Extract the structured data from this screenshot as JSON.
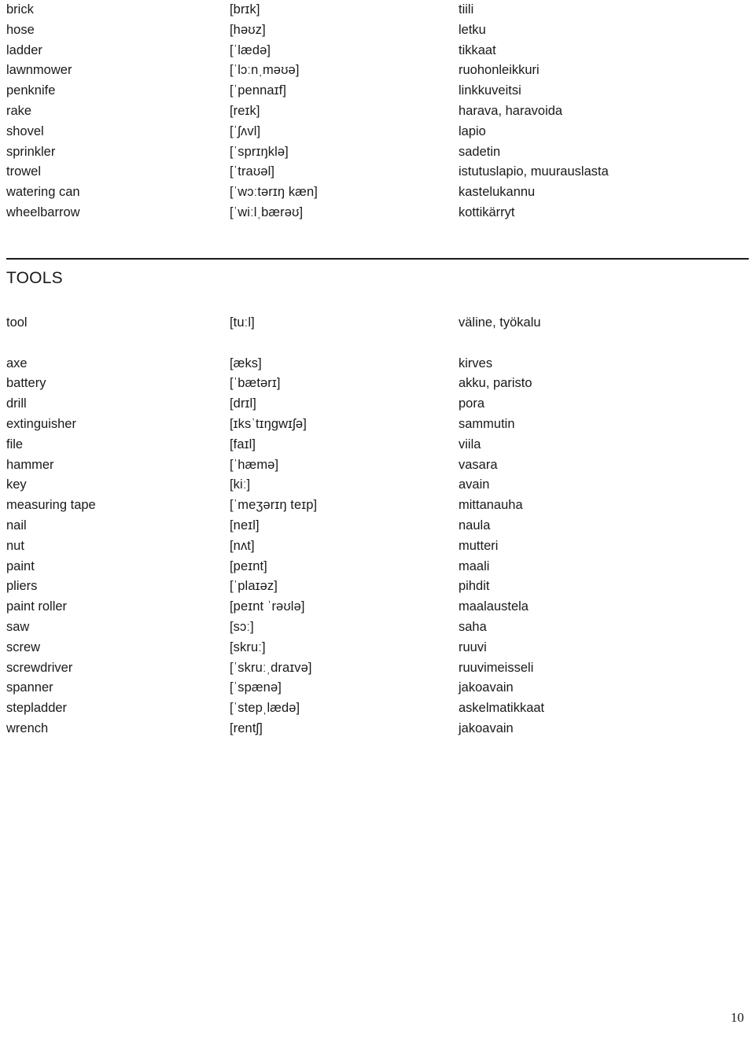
{
  "page": {
    "number": "10"
  },
  "intro_section": {
    "rows": [
      {
        "term": "brick",
        "ipa": "[brɪk]",
        "translation": "tiili"
      },
      {
        "term": "hose",
        "ipa": "[həʊz]",
        "translation": "letku"
      },
      {
        "term": "ladder",
        "ipa": "[ˈlædə]",
        "translation": "tikkaat"
      },
      {
        "term": "lawnmower",
        "ipa": "[ˈlɔːnˌməʊə]",
        "translation": "ruohonleikkuri"
      },
      {
        "term": "penknife",
        "ipa": "[ˈpennaɪf]",
        "translation": "linkkuveitsi"
      },
      {
        "term": "rake",
        "ipa": "[reɪk]",
        "translation": "harava, haravoida"
      },
      {
        "term": "shovel",
        "ipa": "[ˈʃʌvl]",
        "translation": "lapio"
      },
      {
        "term": "sprinkler",
        "ipa": "[ˈsprɪŋklə]",
        "translation": "sadetin"
      },
      {
        "term": "trowel",
        "ipa": "[ˈtraʊəl]",
        "translation": "istutuslapio, muurauslasta"
      },
      {
        "term": "watering can",
        "ipa": "[ˈwɔːtərɪŋ kæn]",
        "translation": "kastelukannu"
      },
      {
        "term": "wheelbarrow",
        "ipa": "[ˈwiːlˌbærəʊ]",
        "translation": "kottikärryt"
      }
    ]
  },
  "tools_section": {
    "heading": "TOOLS",
    "headword": {
      "term": "tool",
      "ipa": "[tuːl]",
      "translation": "väline, työkalu"
    },
    "rows": [
      {
        "term": "axe",
        "ipa": "[æks]",
        "translation": "kirves"
      },
      {
        "term": "battery",
        "ipa": "[ˈbætərɪ]",
        "translation": "akku, paristo"
      },
      {
        "term": "drill",
        "ipa": "[drɪl]",
        "translation": "pora"
      },
      {
        "term": "extinguisher",
        "ipa": "[ɪksˈtɪŋgwɪʃə]",
        "translation": "sammutin"
      },
      {
        "term": "file",
        "ipa": "[faɪl]",
        "translation": "viila"
      },
      {
        "term": "hammer",
        "ipa": "[ˈhæmə]",
        "translation": "vasara"
      },
      {
        "term": "key",
        "ipa": "[kiː]",
        "translation": "avain"
      },
      {
        "term": "measuring tape",
        "ipa": "[ˈmeʒərɪŋ teɪp]",
        "translation": "mittanauha"
      },
      {
        "term": "nail",
        "ipa": "[neɪl]",
        "translation": "naula"
      },
      {
        "term": "nut",
        "ipa": "[nʌt]",
        "translation": "mutteri"
      },
      {
        "term": "paint",
        "ipa": "[peɪnt]",
        "translation": "maali"
      },
      {
        "term": "pliers",
        "ipa": "[ˈplaɪəz]",
        "translation": "pihdit"
      },
      {
        "term": "paint roller",
        "ipa": "[peɪnt ˈrəʊlə]",
        "translation": "maalaustela"
      },
      {
        "term": "saw",
        "ipa": "[sɔː]",
        "translation": "saha"
      },
      {
        "term": "screw",
        "ipa": "[skruː]",
        "translation": "ruuvi"
      },
      {
        "term": "screwdriver",
        "ipa": "[ˈskruːˌdraɪvə]",
        "translation": "ruuvimeisseli"
      },
      {
        "term": "spanner",
        "ipa": "[ˈspænə]",
        "translation": "jakoavain"
      },
      {
        "term": "stepladder",
        "ipa": "[ˈstepˌlædə]",
        "translation": "askelmatikkaat"
      },
      {
        "term": "wrench",
        "ipa": "[rentʃ]",
        "translation": "jakoavain"
      }
    ]
  }
}
